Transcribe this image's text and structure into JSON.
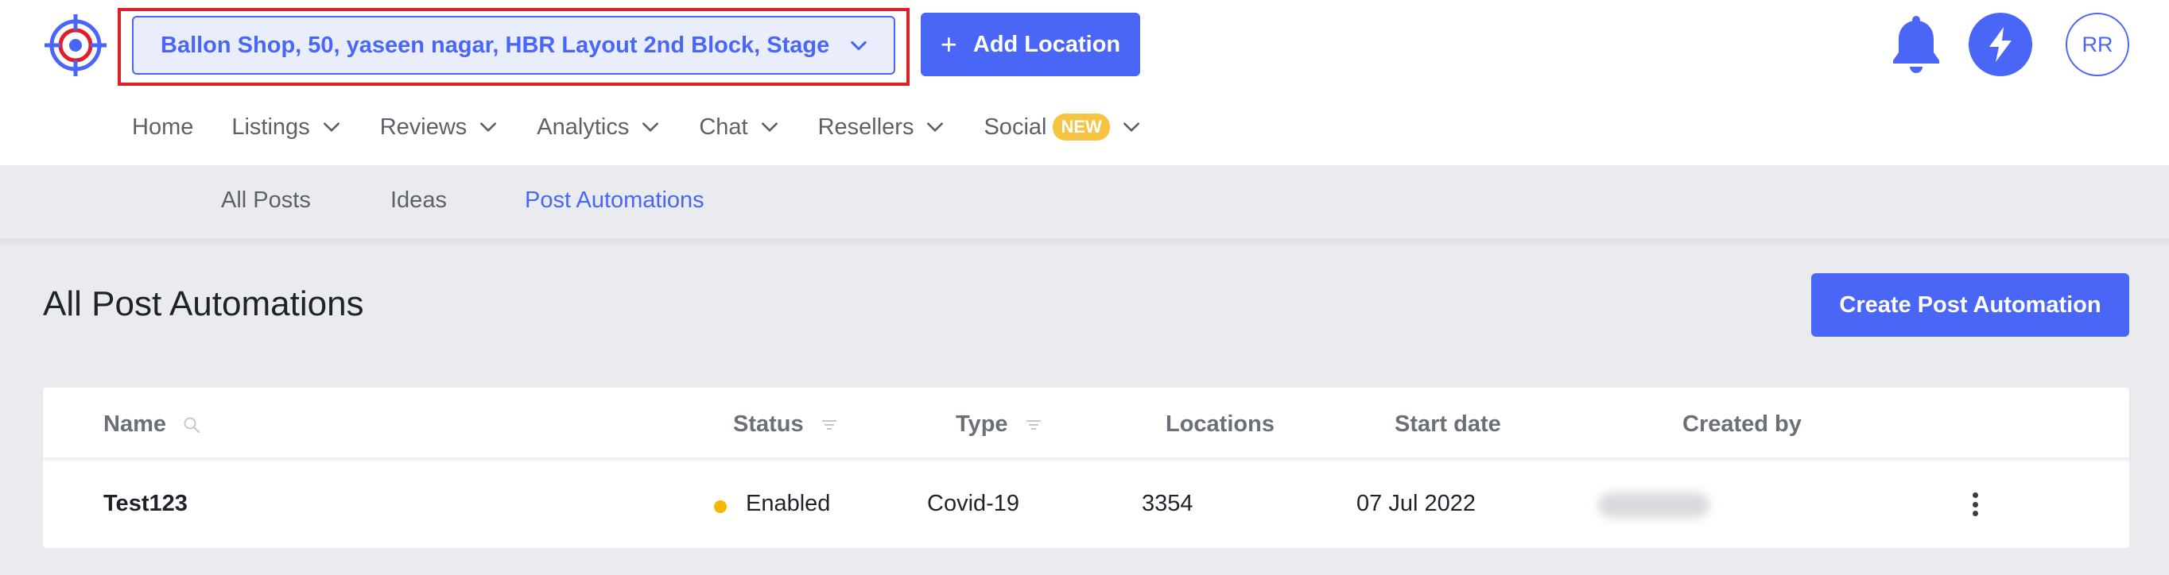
{
  "header": {
    "location_selector": {
      "value": "Ballon Shop, 50, yaseen nagar, HBR Layout 2nd Block, Stage ..."
    },
    "add_location_label": "Add Location",
    "avatar_initials": "RR",
    "icons": {
      "logo": "target-crosshair-logo",
      "bell": "bell-icon",
      "bolt": "lightning-icon"
    },
    "accent_color": "#4a66f7"
  },
  "nav": {
    "items": [
      {
        "label": "Home",
        "has_dropdown": false
      },
      {
        "label": "Listings",
        "has_dropdown": true
      },
      {
        "label": "Reviews",
        "has_dropdown": true
      },
      {
        "label": "Analytics",
        "has_dropdown": true
      },
      {
        "label": "Chat",
        "has_dropdown": true
      },
      {
        "label": "Resellers",
        "has_dropdown": true
      },
      {
        "label": "Social",
        "has_dropdown": true,
        "badge": "NEW"
      }
    ]
  },
  "subnav": {
    "tabs": [
      {
        "label": "All Posts",
        "active": false
      },
      {
        "label": "Ideas",
        "active": false
      },
      {
        "label": "Post Automations",
        "active": true
      }
    ]
  },
  "main": {
    "title": "All Post Automations",
    "create_button_label": "Create Post Automation"
  },
  "table": {
    "columns": [
      "Name",
      "Status",
      "Type",
      "Locations",
      "Start date",
      "Created by"
    ],
    "rows": [
      {
        "name": "Test123",
        "status": "Enabled",
        "status_color": "#f5b800",
        "type": "Covid-19",
        "locations": "3354",
        "start_date": "07 Jul 2022"
      }
    ]
  }
}
